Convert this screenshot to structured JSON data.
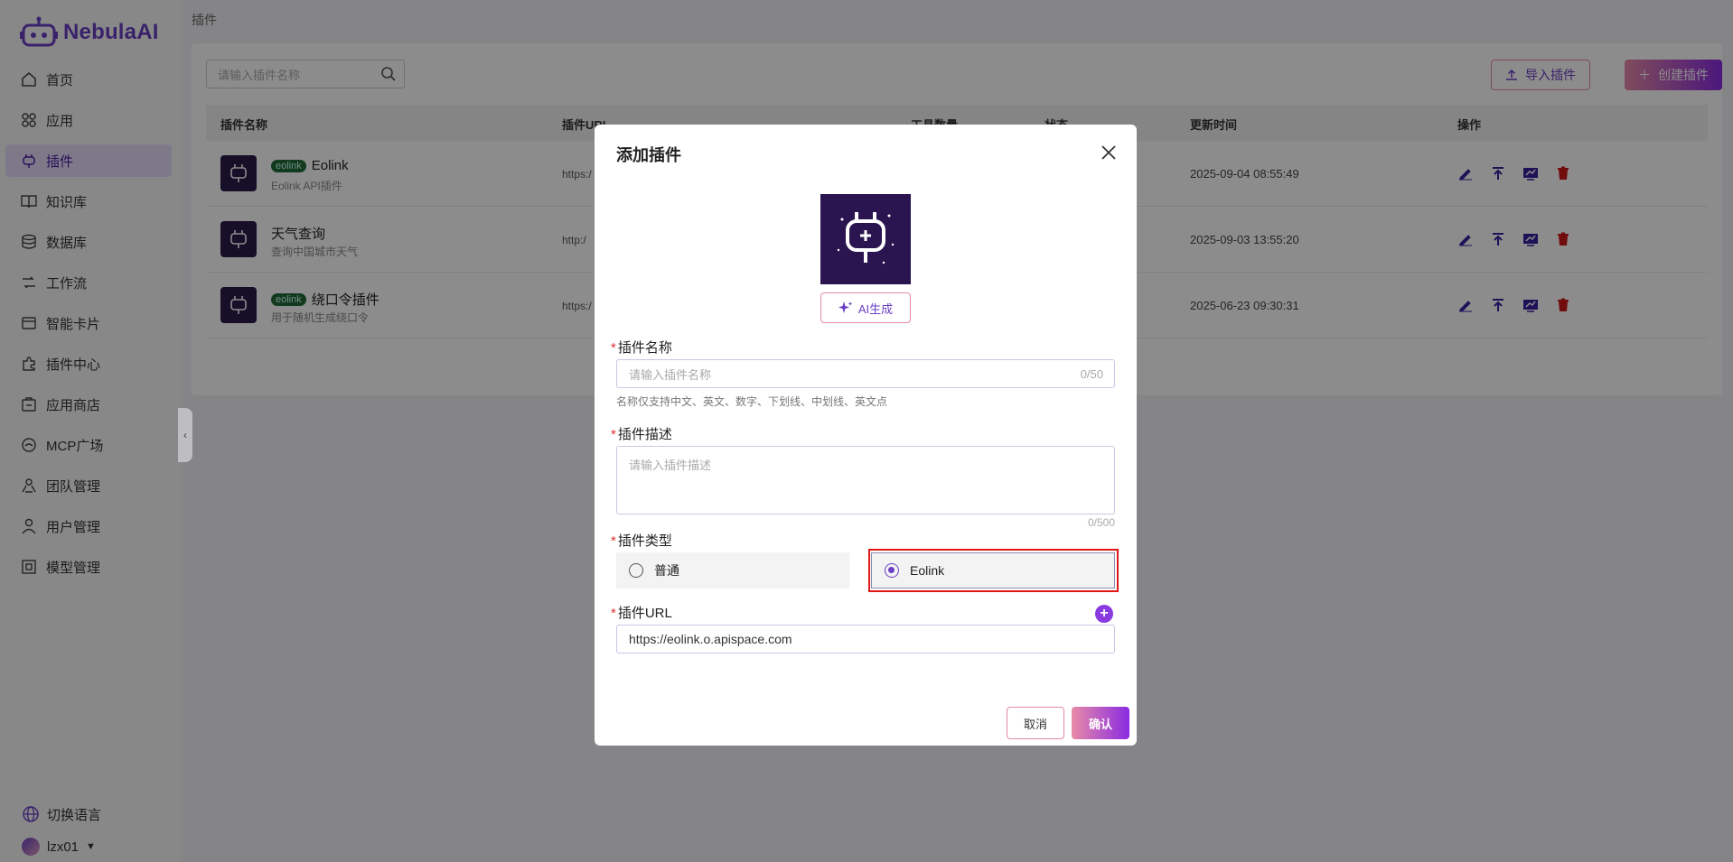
{
  "app": {
    "name": "NebulaAI"
  },
  "sidebar": {
    "items": [
      {
        "label": "首页",
        "icon": "home-icon"
      },
      {
        "label": "应用",
        "icon": "apps-icon"
      },
      {
        "label": "插件",
        "icon": "plugin-icon",
        "active": true
      },
      {
        "label": "知识库",
        "icon": "book-icon"
      },
      {
        "label": "数据库",
        "icon": "database-icon"
      },
      {
        "label": "工作流",
        "icon": "workflow-icon"
      },
      {
        "label": "智能卡片",
        "icon": "card-icon"
      },
      {
        "label": "插件中心",
        "icon": "puzzle-icon"
      },
      {
        "label": "应用商店",
        "icon": "store-icon"
      },
      {
        "label": "MCP广场",
        "icon": "mcp-icon"
      },
      {
        "label": "团队管理",
        "icon": "team-icon"
      },
      {
        "label": "用户管理",
        "icon": "user-icon"
      },
      {
        "label": "模型管理",
        "icon": "model-icon"
      }
    ],
    "language_label": "切换语言",
    "username": "lzx01"
  },
  "main": {
    "breadcrumb": "插件",
    "search_placeholder": "请输入插件名称",
    "import_label": "导入插件",
    "create_label": "创建插件",
    "columns": {
      "name": "插件名称",
      "url": "插件URL",
      "tools": "工具数量",
      "status": "状态",
      "updated": "更新时间",
      "actions": "操作"
    },
    "rows": [
      {
        "tag": "eolink",
        "name": "Eolink",
        "desc": "Eolink API插件",
        "url": "https:/",
        "updated": "2025-09-04 08:55:49"
      },
      {
        "tag": "",
        "name": "天气查询",
        "desc": "查询中国城市天气",
        "url": "http:/",
        "updated": "2025-09-03 13:55:20"
      },
      {
        "tag": "eolink",
        "name": "绕口令插件",
        "desc": "用于随机生成绕口令",
        "url": "https:/",
        "updated": "2025-06-23 09:30:31"
      }
    ]
  },
  "modal": {
    "title": "添加插件",
    "ai_label": "AI生成",
    "name_label": "插件名称",
    "name_placeholder": "请输入插件名称",
    "name_counter": "0/50",
    "name_hint": "名称仅支持中文、英文、数字、下划线、中划线、英文点",
    "desc_label": "插件描述",
    "desc_placeholder": "请输入插件描述",
    "desc_counter": "0/500",
    "type_label": "插件类型",
    "type_normal": "普通",
    "type_eolink": "Eolink",
    "url_label": "插件URL",
    "url_value": "https://eolink.o.apispace.com",
    "cancel_label": "取消",
    "confirm_label": "确认"
  },
  "colors": {
    "accent": "#6b3fc4",
    "highlight": "#e01818"
  }
}
